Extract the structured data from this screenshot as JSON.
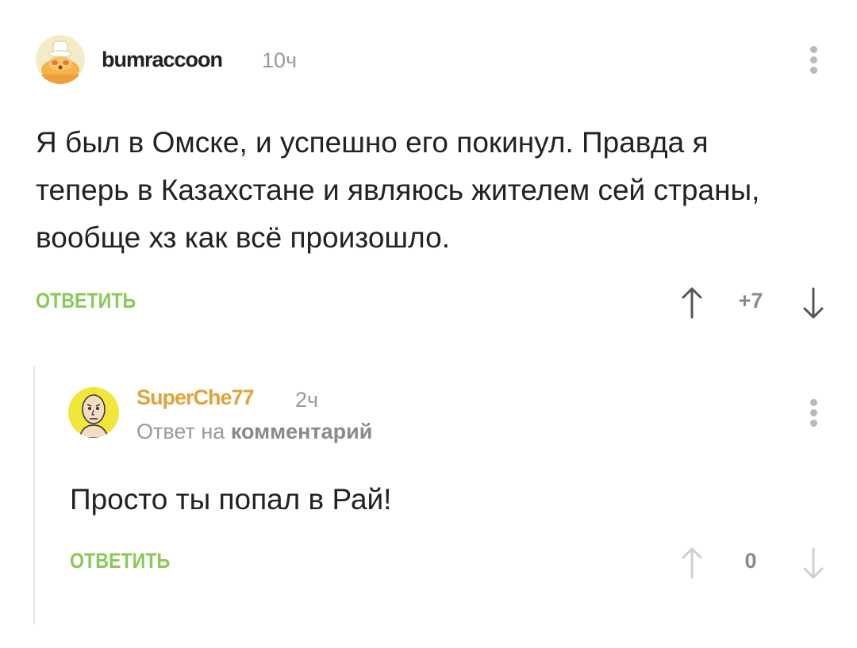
{
  "comments": [
    {
      "username": "bumraccoon",
      "time": "10ч",
      "text": "Я был в Омске, и успешно его покинул. Правда я теперь в Казахстане и являюсь жителем сей страны, вообще хз как всё произошло.",
      "reply_label": "ОТВЕТИТЬ",
      "rating": "+7",
      "username_color": "#222222"
    },
    {
      "username": "SuperChe77",
      "time": "2ч",
      "reply_to_prefix": "Ответ на",
      "reply_to_link": "комментарий",
      "text": "Просто ты попал в Рай!",
      "reply_label": "ОТВЕТИТЬ",
      "rating": "0",
      "username_color": "#e0a33a"
    }
  ],
  "colors": {
    "accent_green": "#8ac858",
    "muted": "#9a9a9a"
  },
  "icons": [
    "more-vertical-icon",
    "arrow-up-icon",
    "arrow-down-icon",
    "avatar-raccoon-chef",
    "avatar-bald-man"
  ]
}
